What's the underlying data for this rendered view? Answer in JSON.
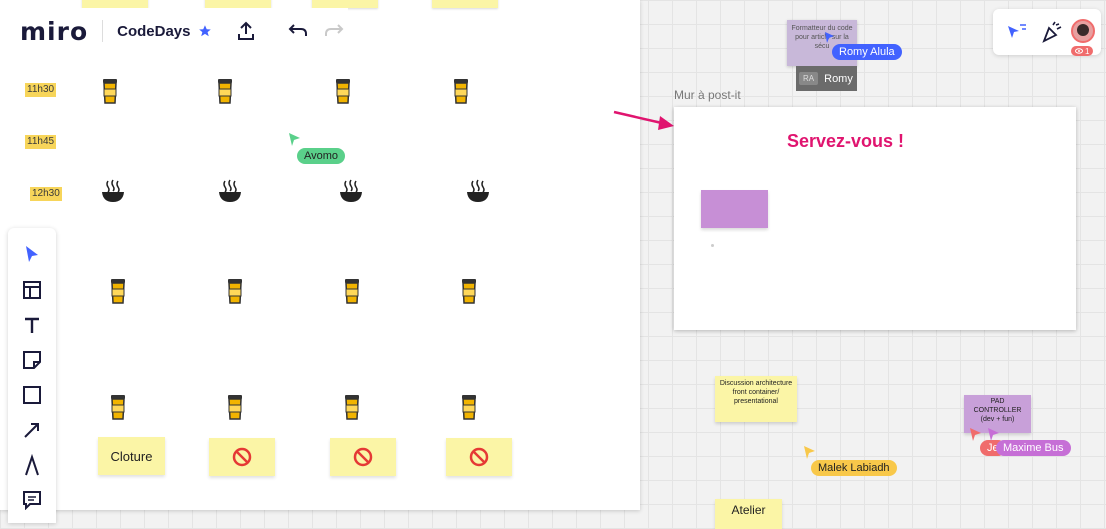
{
  "app": {
    "logo": "miro",
    "board_name": "CodeDays"
  },
  "schedule": {
    "times": [
      "11h30",
      "11h45",
      "12h30"
    ],
    "cloture_label": "Cloture"
  },
  "cursors": {
    "avomo": "Avomo",
    "romy_alula": "Romy Alula",
    "romy": "Romy",
    "romy_initials": "RA",
    "malek": "Malek Labiadh",
    "maxime": "Maxime Bus",
    "partial_name": "Je"
  },
  "frame": {
    "label": "Mur à post-it",
    "title": "Servez-vous !"
  },
  "stickies": {
    "romy_note": "Formatteur du code pour article sur la sécu",
    "discussion": "Discussion architecture front container/ presentational",
    "pad": "PAD CONTROLLER (dev + fun)",
    "atelier": "Atelier"
  },
  "presence": {
    "viewer_count": "1"
  },
  "colors": {
    "accent_pink": "#e0146f",
    "cursor_blue": "#4262ff",
    "cursor_green": "#5ad08a",
    "cursor_yellow": "#f8c84a",
    "cursor_purple": "#c66fd6"
  }
}
